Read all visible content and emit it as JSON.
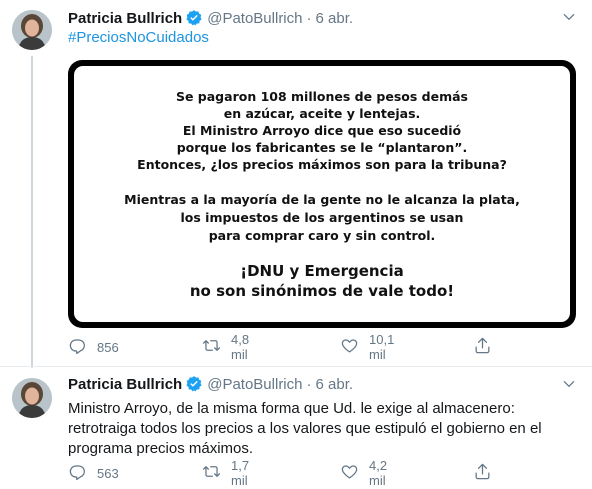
{
  "tweets": [
    {
      "author": "Patricia Bullrich",
      "handle": "@PatoBullrich",
      "separator": "·",
      "date": "6 abr.",
      "hashtag": "#PreciosNoCuidados",
      "image_text": {
        "para1": [
          "Se pagaron 108 millones de pesos demás",
          "en azúcar, aceite y lentejas.",
          "El Ministro Arroyo dice que eso sucedió",
          "porque los fabricantes se le “plantaron”.",
          "Entonces, ¿los precios máximos son para la tribuna?"
        ],
        "para2": [
          "Mientras a la mayoría de la gente no le alcanza la plata,",
          "los impuestos de los argentinos se usan",
          "para comprar caro y sin control."
        ],
        "para3": [
          "¡DNU y Emergencia",
          "no son sinónimos de vale todo!"
        ]
      },
      "replies": "856",
      "retweets": "4,8 mil",
      "likes": "10,1 mil"
    },
    {
      "author": "Patricia Bullrich",
      "handle": "@PatoBullrich",
      "separator": "·",
      "date": "6 abr.",
      "text": "Ministro Arroyo, de la misma forma que Ud. le exige al almacenero: retrotraiga todos los precios a los valores que estipuló el gobierno en el programa precios máximos.",
      "replies": "563",
      "retweets": "1,7 mil",
      "likes": "4,2 mil"
    }
  ],
  "colors": {
    "link": "#1b95e0",
    "verified": "#1da1f2",
    "muted": "#657786"
  }
}
